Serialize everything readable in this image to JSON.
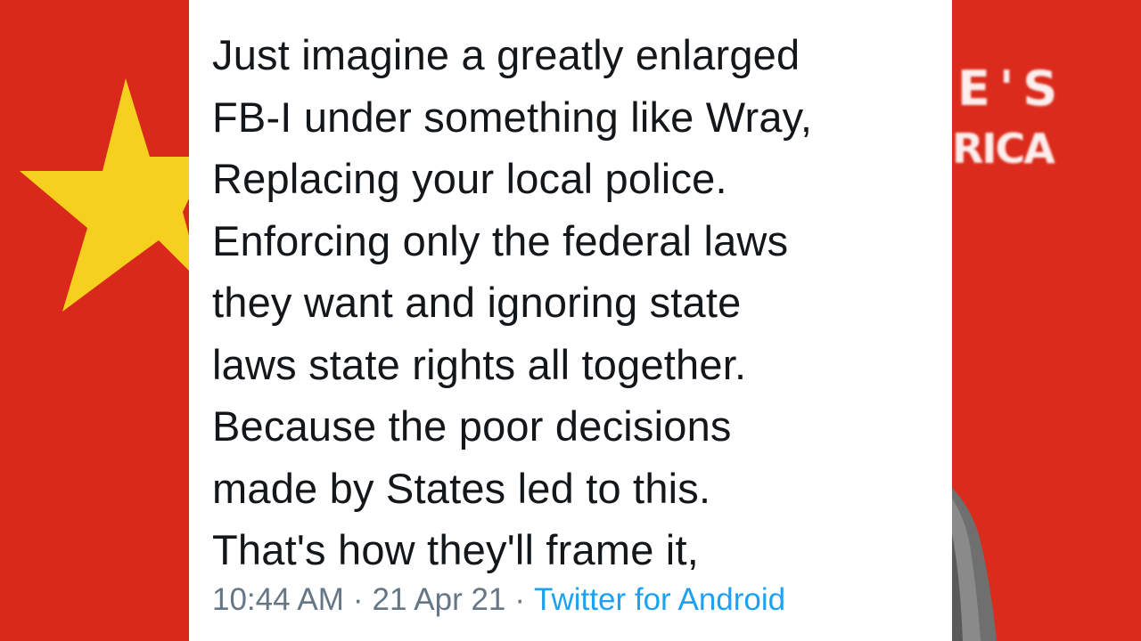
{
  "background": {
    "left_color": "#d8291a",
    "right_color": "#db2b1c",
    "star_color": "#f5d01e",
    "right_banner": {
      "line_1": "E'S",
      "line_2": "RICA"
    }
  },
  "tweet": {
    "lines": [
      "Just imagine a greatly enlarged",
      "FB-I under something like Wray,",
      "Replacing your local police.",
      "Enforcing only the federal laws",
      "they want and ignoring state",
      "laws state rights all together.",
      "Because the poor decisions",
      "made by States led to this.",
      "That's how they'll frame it,"
    ],
    "time": "10:44 AM",
    "date": "21 Apr 21",
    "separator": "·",
    "source": "Twitter for Android",
    "text_color": "#14171a",
    "meta_color": "#657786",
    "link_color": "#1da1f2"
  }
}
